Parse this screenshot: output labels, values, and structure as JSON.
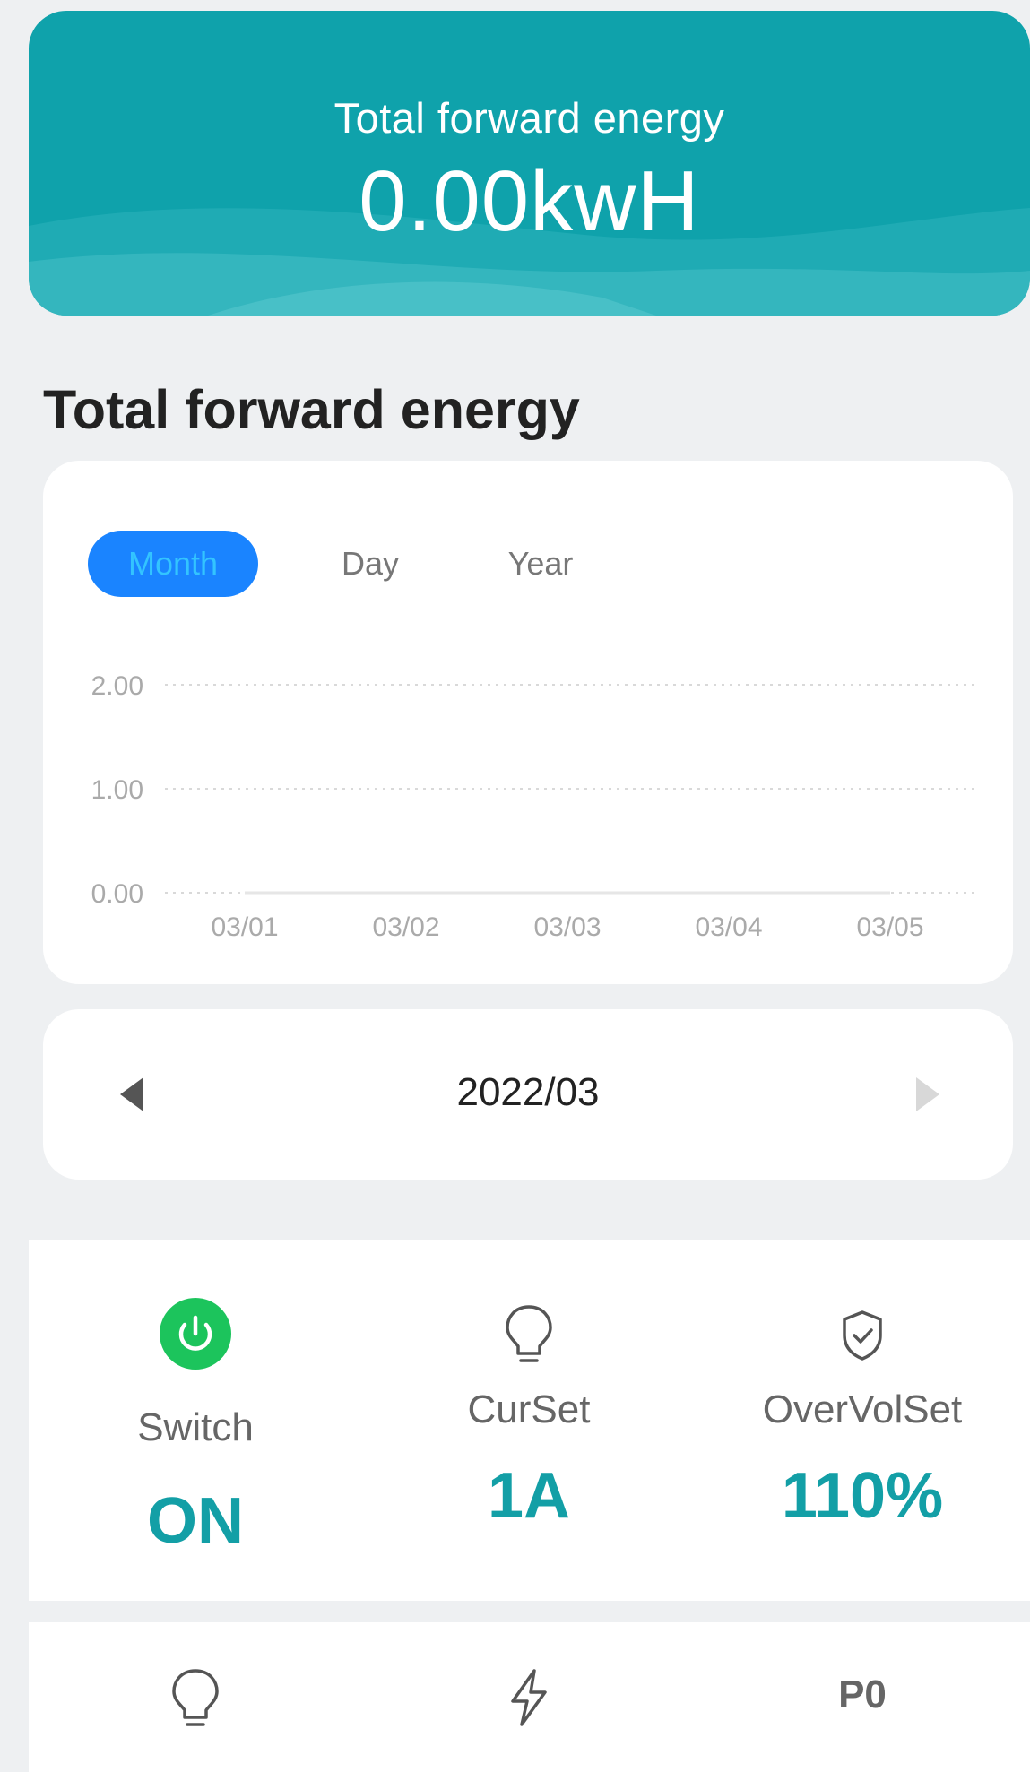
{
  "hero": {
    "label": "Total forward energy",
    "value": "0.00kwH",
    "color": "#0fa2ab"
  },
  "section": {
    "title": "Total forward energy"
  },
  "tabs": [
    {
      "label": "Month",
      "active": true
    },
    {
      "label": "Day",
      "active": false
    },
    {
      "label": "Year",
      "active": false
    }
  ],
  "chart_data": {
    "type": "line",
    "categories": [
      "03/01",
      "03/02",
      "03/03",
      "03/04",
      "03/05"
    ],
    "series": [
      {
        "values": [
          0,
          0,
          0,
          0,
          0
        ]
      }
    ],
    "yticks": [
      "2.00",
      "1.00",
      "0.00"
    ],
    "ylim": [
      0,
      2
    ],
    "grid": true,
    "title": "",
    "xlabel": "",
    "ylabel": ""
  },
  "nav": {
    "date": "2022/03",
    "prev_icon": "left-triangle-icon",
    "next_icon": "right-triangle-icon"
  },
  "stats": [
    {
      "icon": "power-icon",
      "label": "Switch",
      "value": "ON"
    },
    {
      "icon": "lightbulb-icon",
      "label": "CurSet",
      "value": "1A"
    },
    {
      "icon": "shield-check-icon",
      "label": "OverVolSet",
      "value": "110%"
    }
  ],
  "bottom": [
    {
      "icon": "lightbulb-icon",
      "text": ""
    },
    {
      "icon": "lightning-icon",
      "text": ""
    },
    {
      "icon": "",
      "text": "P0"
    }
  ],
  "colors": {
    "accent": "#139fa6",
    "tab_active_bg": "#1a84ff",
    "power_green": "#1cc45c"
  }
}
